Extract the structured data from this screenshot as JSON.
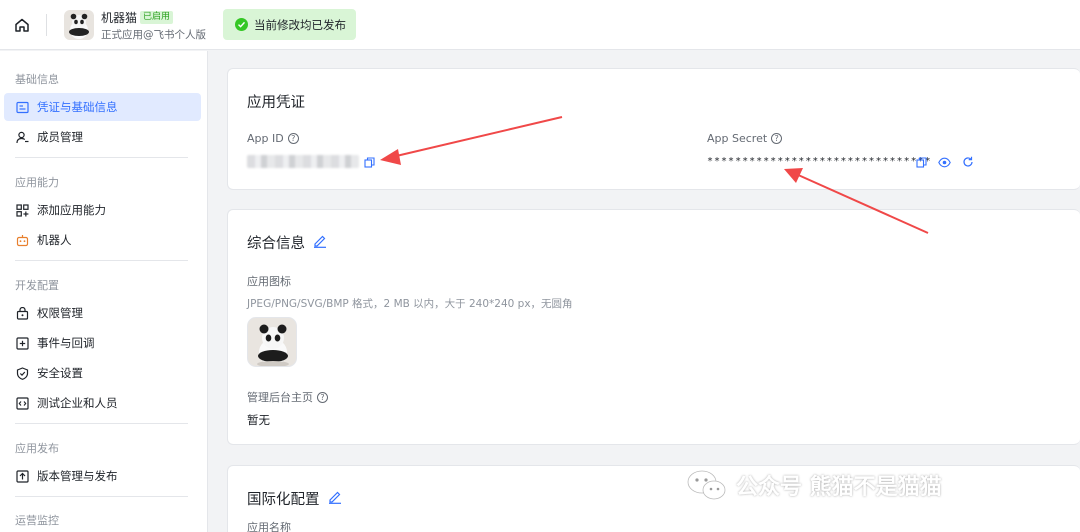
{
  "topbar": {
    "app_name": "机器猫",
    "app_badge": "已启用",
    "app_sub": "正式应用@飞书个人版",
    "publish_status": "当前修改均已发布"
  },
  "sidebar": {
    "sections": [
      {
        "title": "基础信息",
        "items": [
          {
            "label": "凭证与基础信息",
            "icon": "credential-icon",
            "active": true
          },
          {
            "label": "成员管理",
            "icon": "member-icon"
          }
        ]
      },
      {
        "title": "应用能力",
        "items": [
          {
            "label": "添加应用能力",
            "icon": "grid-add-icon"
          },
          {
            "label": "机器人",
            "icon": "robot-icon"
          }
        ]
      },
      {
        "title": "开发配置",
        "items": [
          {
            "label": "权限管理",
            "icon": "permission-icon"
          },
          {
            "label": "事件与回调",
            "icon": "event-icon"
          },
          {
            "label": "安全设置",
            "icon": "shield-icon"
          },
          {
            "label": "测试企业和人员",
            "icon": "test-icon"
          }
        ]
      },
      {
        "title": "应用发布",
        "items": [
          {
            "label": "版本管理与发布",
            "icon": "upload-icon"
          }
        ]
      },
      {
        "title": "运营监控",
        "items": []
      }
    ]
  },
  "credentials": {
    "title": "应用凭证",
    "app_id_label": "App ID",
    "app_secret_label": "App Secret",
    "app_secret_value": "********************************"
  },
  "general": {
    "title": "综合信息",
    "icon_label": "应用图标",
    "icon_hint": "JPEG/PNG/SVG/BMP 格式，2 MB 以内，大于 240*240 px，无圆角",
    "homepage_label": "管理后台主页",
    "homepage_value": "暂无"
  },
  "i18n": {
    "title": "国际化配置",
    "name_label": "应用名称"
  },
  "watermark": {
    "text": "公众号 熊猫不是猫猫"
  },
  "colors": {
    "accent": "#3370ff",
    "success": "#34c724",
    "arrow": "#f04848"
  }
}
